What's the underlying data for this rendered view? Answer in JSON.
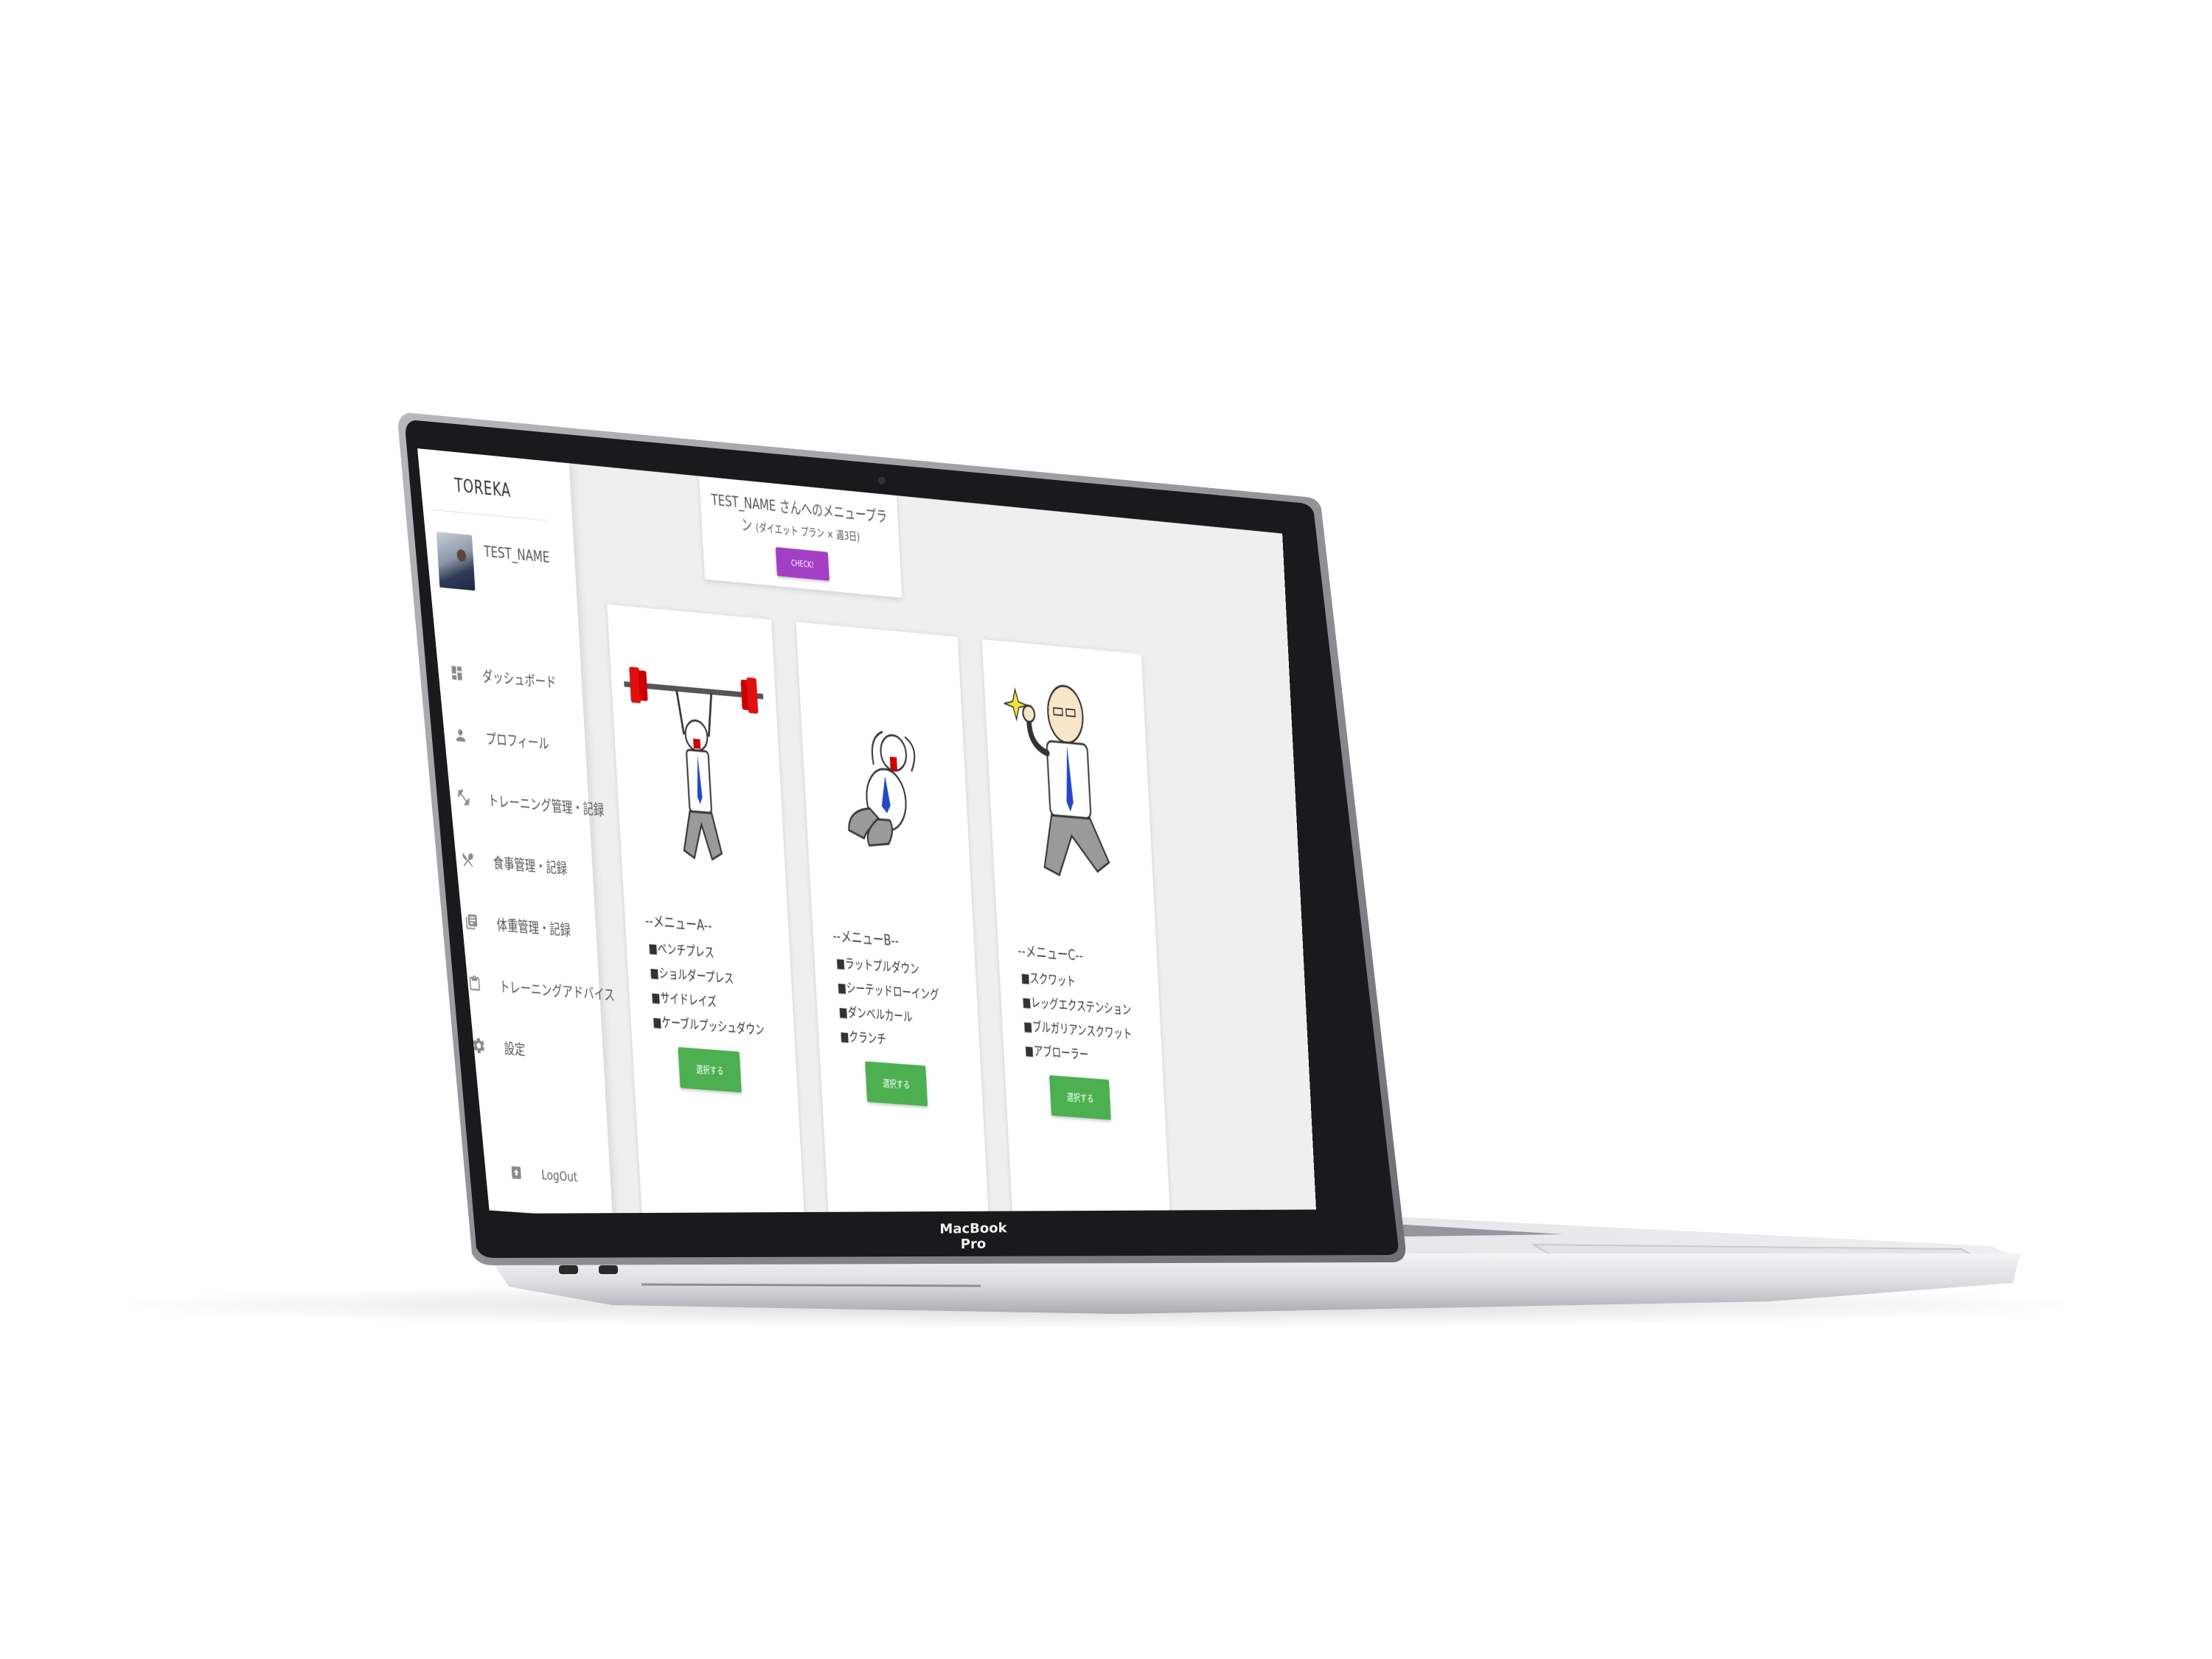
{
  "device_label": "MacBook Pro",
  "app": {
    "logo": "TOREKA"
  },
  "user": {
    "name": "TEST_NAME"
  },
  "sidebar": {
    "items": [
      {
        "label": "ダッシュボード",
        "icon": "dashboard-icon"
      },
      {
        "label": "プロフィール",
        "icon": "person-icon"
      },
      {
        "label": "トレーニング管理・記録",
        "icon": "fitness-icon"
      },
      {
        "label": "食事管理・記録",
        "icon": "restaurant-icon"
      },
      {
        "label": "体重管理・記録",
        "icon": "notes-icon"
      },
      {
        "label": "トレーニングアドバイス",
        "icon": "clipboard-icon"
      },
      {
        "label": "設定",
        "icon": "gear-icon"
      }
    ],
    "logout": {
      "label": "LogOut",
      "icon": "logout-icon"
    }
  },
  "plan": {
    "title": "TEST_NAME さんへのメニュープラン",
    "detail": "(ダイエット プラン × 週3日)",
    "button": "CHECK!"
  },
  "menus": [
    {
      "title": "--メニューA--",
      "items": [
        "■ベンチプレス",
        "■ショルダープレス",
        "■サイドレイズ",
        "■ケーブルプッシュダウン"
      ],
      "button": "選択する"
    },
    {
      "title": "--メニューB--",
      "items": [
        "■ラットプルダウン",
        "■シーテッドローイング",
        "■ダンベルカール",
        "■クランチ"
      ],
      "button": "選択する"
    },
    {
      "title": "--メニューC--",
      "items": [
        "■スクワット",
        "■レッグエクステンション",
        "■ブルガリアンスクワット",
        "■アブローラー"
      ],
      "button": "選択する"
    }
  ],
  "colors": {
    "check_button": "#a23fc4",
    "select_button": "#4caf50",
    "sidebar_bg": "#ffffff",
    "main_bg": "#efefef"
  }
}
